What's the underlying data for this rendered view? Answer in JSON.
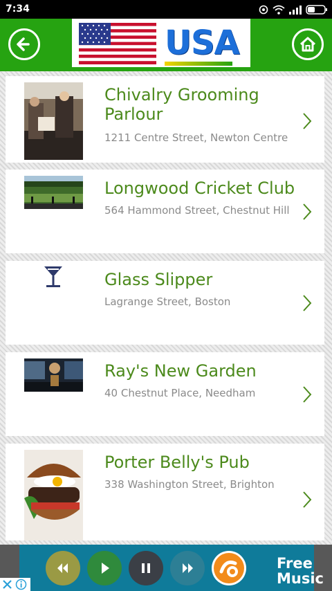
{
  "status_bar": {
    "time": "7:34"
  },
  "header": {
    "country_label": "USA"
  },
  "venues": [
    {
      "title_line1": "Chivalry Grooming",
      "title_line2": "Parlour",
      "address": "1211 Centre Street, Newton Centre",
      "image": "barbershop-photo"
    },
    {
      "title_line1": "Longwood Cricket Club",
      "title_line2": "",
      "address": "564 Hammond Street, Chestnut Hill",
      "image": "cricket-ground-photo"
    },
    {
      "title_line1": "Glass Slipper",
      "title_line2": "",
      "address": "Lagrange Street, Boston",
      "image": "cocktail-glass-icon"
    },
    {
      "title_line1": "Ray's New Garden",
      "title_line2": "",
      "address": "40 Chestnut Place, Needham",
      "image": "bar-interior-photo"
    },
    {
      "title_line1": "Porter Belly's Pub",
      "title_line2": "",
      "address": "338 Washington Street, Brighton",
      "image": "burger-photo"
    }
  ],
  "ad": {
    "line1": "Free",
    "line2": "Music"
  },
  "colors": {
    "header_green": "#26a311",
    "title_green": "#4c8a1c",
    "address_gray": "#8a8a8a"
  }
}
